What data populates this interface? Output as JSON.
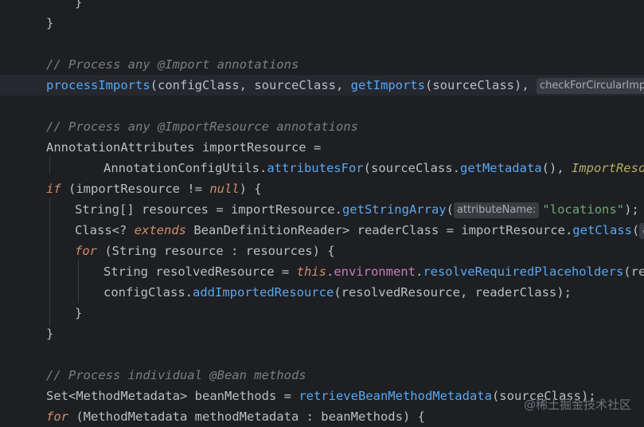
{
  "editor": {
    "lines": [
      {
        "text": "}",
        "kind": "brace"
      },
      {
        "text": "}",
        "kind": "brace"
      },
      {
        "text": "// Process any @Import annotations",
        "kind": "comment"
      },
      {
        "kind": "code",
        "tokens": [
          "processImports",
          "(",
          "configClass",
          ", ",
          "sourceClass",
          ", ",
          "getImports",
          "(",
          "sourceClass",
          "), "
        ],
        "hint": "checkForCircularImpor"
      },
      {
        "text": "// Process any @ImportResource annotations",
        "kind": "comment"
      },
      {
        "tokens": [
          "AnnotationAttributes",
          " importResource ="
        ]
      },
      {
        "tokens": [
          "AnnotationConfigUtils",
          ".",
          "attributesFor",
          "(",
          "sourceClass",
          ".",
          "getMetadata",
          "(), ",
          "ImportResourc"
        ]
      },
      {
        "tokens": [
          "if",
          " (importResource != ",
          "null",
          ") {"
        ]
      },
      {
        "tokens": [
          "String",
          "[] resources = importResource.",
          "getStringArray",
          "(",
          "\"locations\"",
          ");"
        ],
        "hint": "attributeName:"
      },
      {
        "tokens": [
          "Class",
          "<? ",
          "extends",
          " ",
          "BeanDefinitionReader",
          "> readerClass = importResource.",
          "getClass",
          "("
        ],
        "hint": "attr"
      },
      {
        "tokens": [
          "for",
          " (",
          "String",
          " resource : resources) {"
        ]
      },
      {
        "tokens": [
          "String",
          " resolvedResource = ",
          "this",
          ".",
          "environment",
          ".",
          "resolveRequiredPlaceholders",
          "(resou"
        ]
      },
      {
        "tokens": [
          "configClass",
          ".",
          "addImportedResource",
          "(resolvedResource, readerClass);"
        ]
      },
      {
        "text": "}",
        "kind": "brace"
      },
      {
        "text": "}",
        "kind": "brace"
      },
      {
        "text": "// Process individual @Bean methods",
        "kind": "comment"
      },
      {
        "tokens": [
          "Set",
          "<",
          "MethodMetadata",
          "> beanMethods = ",
          "retrieveBeanMethodMetadata",
          "(",
          "sourceClass",
          ");"
        ]
      },
      {
        "tokens": [
          "for",
          " (",
          "MethodMetadata",
          " methodMetadata : beanMethods) {"
        ]
      }
    ]
  },
  "watermark": "@稀土掘金技术社区"
}
